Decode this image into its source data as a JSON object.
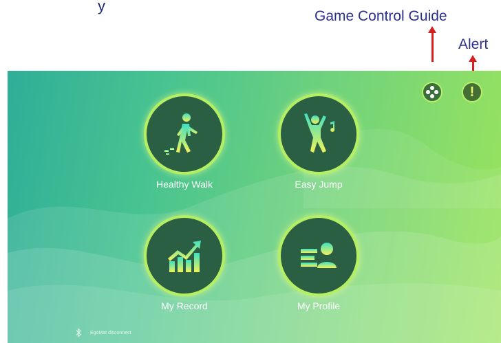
{
  "annotations": {
    "game_control_guide": "Game Control Guide",
    "alert": "Alert",
    "top_fragment": "y"
  },
  "menu": {
    "items": [
      {
        "label": "Healthy Walk",
        "icon": "walking-person-icon"
      },
      {
        "label": "Easy Jump",
        "icon": "jumping-person-icon"
      },
      {
        "label": "My Record",
        "icon": "chart-trend-icon"
      },
      {
        "label": "My Profile",
        "icon": "profile-card-icon"
      }
    ]
  },
  "status": {
    "label": "EgoMat disconnect",
    "icon": "bluetooth-icon"
  },
  "colors": {
    "annotation_text": "#2c2f8c",
    "arrow": "#d21f1f",
    "circle_fill": "#2a5f43",
    "circle_ring": "#b4ef63",
    "icon_gradient_start": "#3fe0c2",
    "icon_gradient_end": "#f0f25a"
  }
}
